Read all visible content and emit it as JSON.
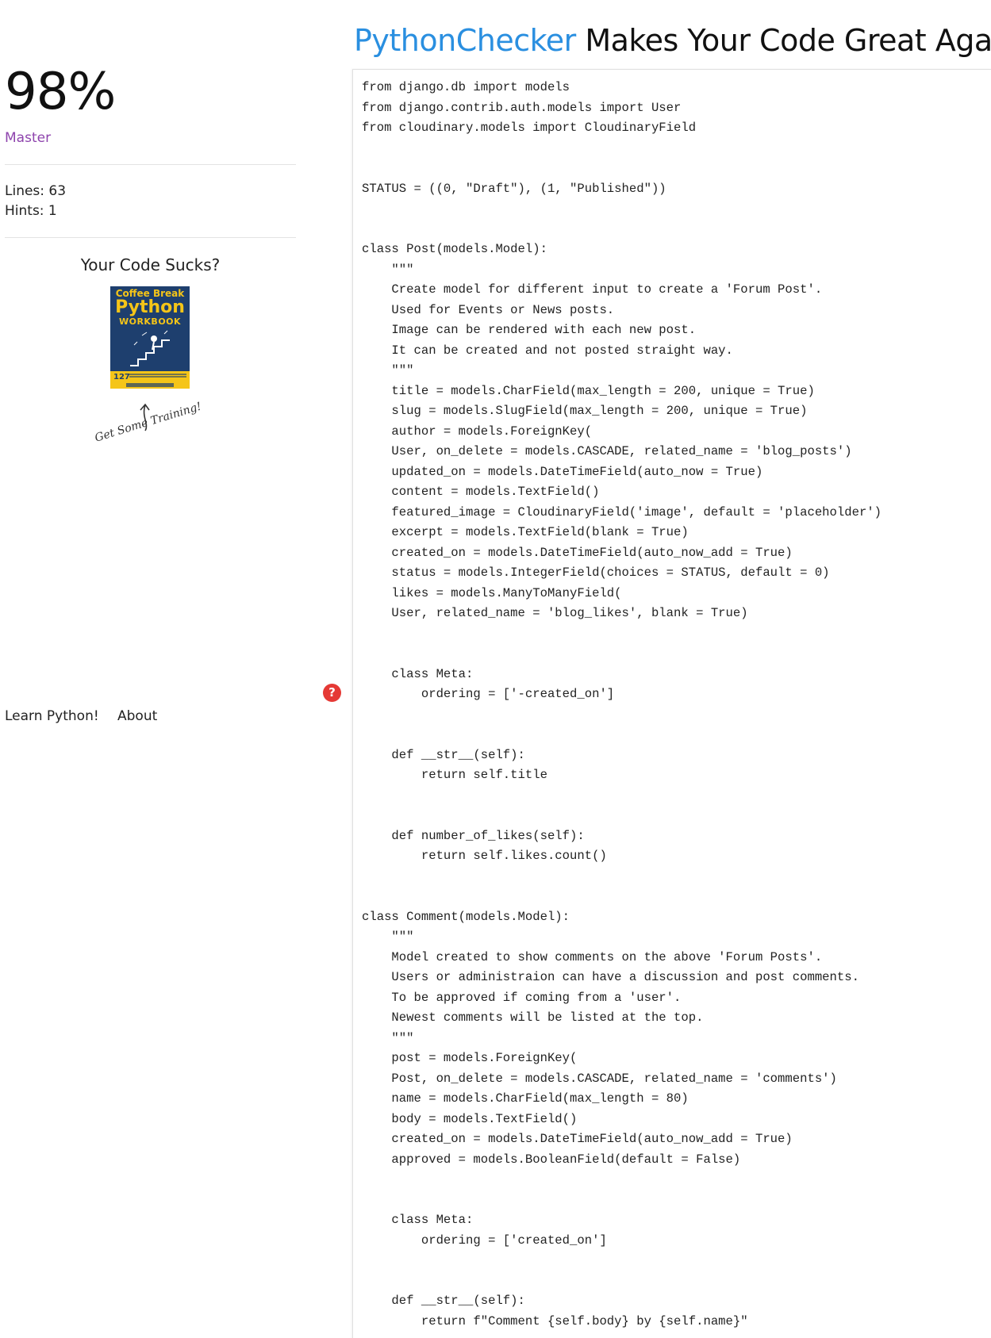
{
  "header": {
    "brand": "PythonChecker",
    "tagline": "Makes Your Code Great Again"
  },
  "sidebar": {
    "score": "98%",
    "level": "Master",
    "lines": "Lines: 63",
    "hints": "Hints: 1",
    "promo_title": "Your Code Sucks?",
    "book": {
      "line1": "Coffee Break",
      "line2": "Python",
      "line3": "WORKBOOK",
      "number": "127"
    },
    "training_text": "Get Some Training!"
  },
  "help_icon": "?",
  "footer": {
    "links": [
      "Learn Python!",
      "About"
    ]
  },
  "colors": {
    "brand": "#2a8fe0",
    "level": "#8e44ad",
    "help": "#e53935"
  },
  "code_lines": [
    "from django.db import models",
    "from django.contrib.auth.models import User",
    "from cloudinary.models import CloudinaryField",
    "",
    "",
    "STATUS = ((0, \"Draft\"), (1, \"Published\"))",
    "",
    "",
    "class Post(models.Model):",
    "    \"\"\"",
    "    Create model for different input to create a 'Forum Post'.",
    "    Used for Events or News posts.",
    "    Image can be rendered with each new post.",
    "    It can be created and not posted straight way.",
    "    \"\"\"",
    "    title = models.CharField(max_length = 200, unique = True)",
    "    slug = models.SlugField(max_length = 200, unique = True)",
    "    author = models.ForeignKey(",
    "    User, on_delete = models.CASCADE, related_name = 'blog_posts')",
    "    updated_on = models.DateTimeField(auto_now = True)",
    "    content = models.TextField()",
    "    featured_image = CloudinaryField('image', default = 'placeholder')",
    "    excerpt = models.TextField(blank = True)",
    "    created_on = models.DateTimeField(auto_now_add = True)",
    "    status = models.IntegerField(choices = STATUS, default = 0)",
    "    likes = models.ManyToManyField(",
    "    User, related_name = 'blog_likes', blank = True)",
    "",
    "",
    "    class Meta:",
    "        ordering = ['-created_on']",
    "",
    "",
    "    def __str__(self):",
    "        return self.title",
    "",
    "",
    "    def number_of_likes(self):",
    "        return self.likes.count()",
    "",
    "",
    "class Comment(models.Model):",
    "    \"\"\"",
    "    Model created to show comments on the above 'Forum Posts'.",
    "    Users or administraion can have a discussion and post comments.",
    "    To be approved if coming from a 'user'.",
    "    Newest comments will be listed at the top.",
    "    \"\"\"",
    "    post = models.ForeignKey(",
    "    Post, on_delete = models.CASCADE, related_name = 'comments')",
    "    name = models.CharField(max_length = 80)",
    "    body = models.TextField()",
    "    created_on = models.DateTimeField(auto_now_add = True)",
    "    approved = models.BooleanField(default = False)",
    "",
    "",
    "    class Meta:",
    "        ordering = ['created_on']",
    "",
    "",
    "    def __str__(self):",
    "        return f\"Comment {self.body} by {self.name}\""
  ]
}
